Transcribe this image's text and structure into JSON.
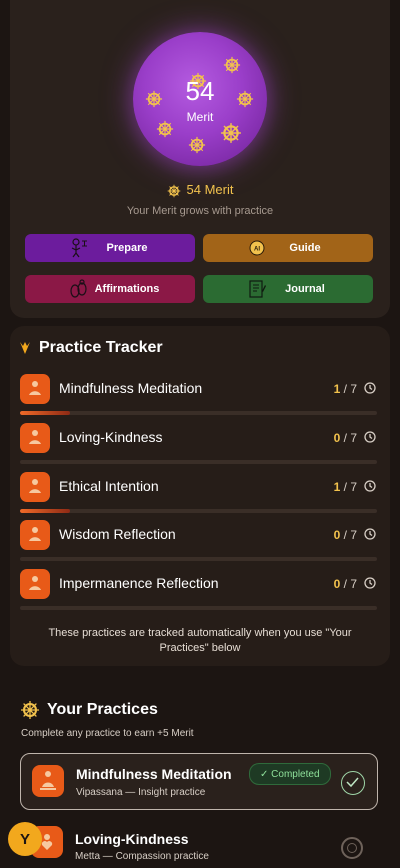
{
  "colors": {
    "accent_gold": "#f2c24d",
    "orb_purple": "#9a3ec9",
    "practice_orange": "#e85a18"
  },
  "merit": {
    "orb_value": "54",
    "orb_label": "Merit",
    "summary": "54 Merit",
    "subtitle": "Your Merit grows with practice"
  },
  "actions": {
    "prepare": "Prepare",
    "guide": "Guide",
    "affirmations": "Affirmations",
    "journal": "Journal"
  },
  "tracker": {
    "title": "Practice Tracker",
    "rows": [
      {
        "name": "Mindfulness Meditation",
        "done": "1",
        "total": "/ 7",
        "progress": 0.14,
        "icon": "meditation-icon"
      },
      {
        "name": "Loving-Kindness",
        "done": "0",
        "total": "/ 7",
        "progress": 0,
        "icon": "heart-icon"
      },
      {
        "name": "Ethical Intention",
        "done": "1",
        "total": "/ 7",
        "progress": 0.14,
        "icon": "ethics-icon"
      },
      {
        "name": "Wisdom Reflection",
        "done": "0",
        "total": "/ 7",
        "progress": 0,
        "icon": "wisdom-icon"
      },
      {
        "name": "Impermanence Reflection",
        "done": "0",
        "total": "/ 7",
        "progress": 0,
        "icon": "impermanence-icon"
      }
    ],
    "note": "These practices are tracked automatically when you use \"Your Practices\" below"
  },
  "practices": {
    "title": "Your Practices",
    "subtitle": "Complete any practice to earn +5 Merit",
    "items": [
      {
        "name": "Mindfulness Meditation",
        "sub": "Vipassana — Insight practice",
        "badge": "✓ Completed"
      },
      {
        "name": "Loving-Kindness",
        "sub": "Metta — Compassion practice"
      }
    ]
  },
  "avatar": {
    "initial": "Y"
  }
}
